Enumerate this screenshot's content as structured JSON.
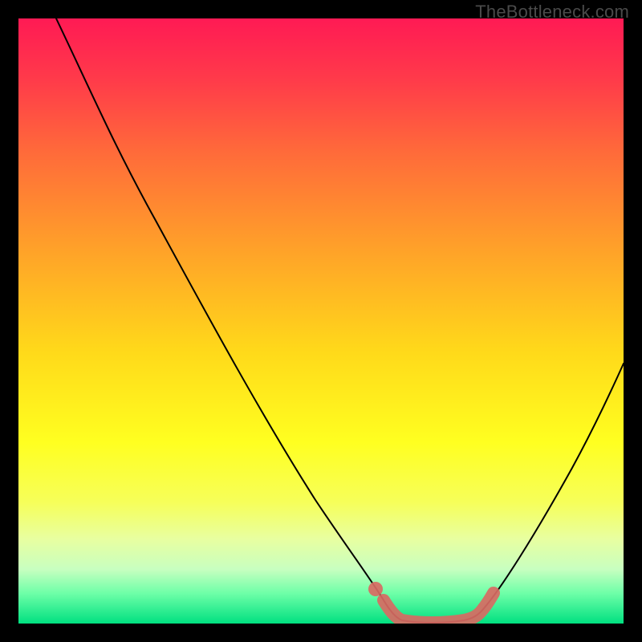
{
  "watermark": "TheBottleneck.com",
  "colors": {
    "background": "#000000",
    "gradient_top": "#ff1a54",
    "gradient_bottom": "#00e080",
    "curve": "#000000",
    "highlight": "#d86a63"
  },
  "chart_data": {
    "type": "line",
    "title": "",
    "xlabel": "",
    "ylabel": "",
    "xlim": [
      0,
      100
    ],
    "ylim": [
      0,
      100
    ],
    "axes_visible": false,
    "grid": false,
    "legend": false,
    "annotations": [
      "TheBottleneck.com"
    ],
    "series": [
      {
        "name": "left-descent",
        "x": [
          0,
          6,
          12,
          18,
          24,
          30,
          36,
          42,
          48,
          54,
          58,
          60,
          62
        ],
        "y": [
          100,
          94,
          86,
          76,
          66,
          55,
          44,
          33,
          22,
          12,
          6,
          3,
          1
        ]
      },
      {
        "name": "valley-floor",
        "x": [
          62,
          65,
          68,
          71,
          74,
          76
        ],
        "y": [
          1,
          0.5,
          0.5,
          0.5,
          1,
          2
        ]
      },
      {
        "name": "right-ascent",
        "x": [
          76,
          80,
          84,
          88,
          92,
          96,
          100
        ],
        "y": [
          2,
          8,
          17,
          27,
          38,
          50,
          58
        ]
      }
    ],
    "highlight_segment": {
      "name": "optimal-zone",
      "x": [
        59,
        62,
        66,
        70,
        74,
        76
      ],
      "y": [
        5,
        1,
        0.5,
        0.5,
        1,
        3
      ]
    },
    "highlight_marker": {
      "x": 59,
      "y": 5
    }
  }
}
